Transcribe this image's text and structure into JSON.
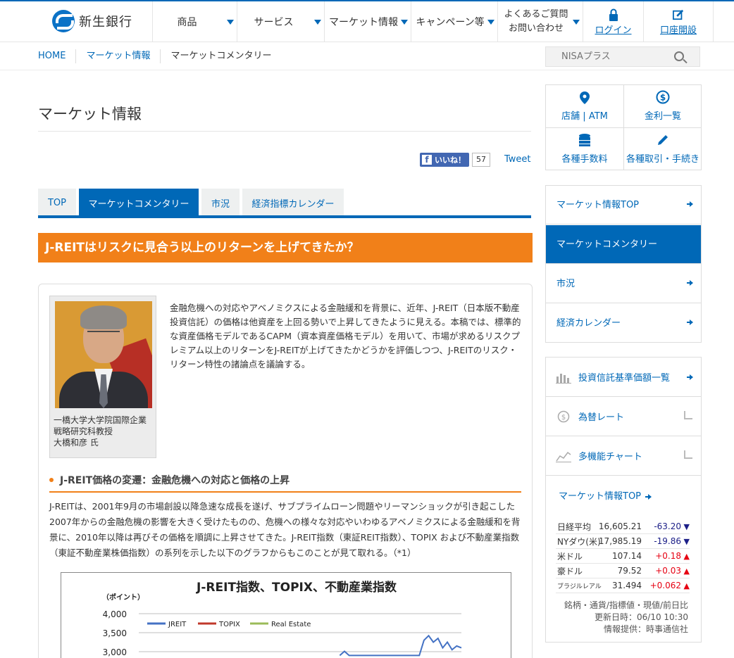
{
  "header": {
    "logo_text": "新生銀行",
    "nav": [
      {
        "label": "商品"
      },
      {
        "label": "サービス"
      },
      {
        "label": "マーケット情報"
      },
      {
        "label": "キャンペーン等"
      }
    ],
    "faq_line1": "よくあるご質問",
    "faq_line2": "お問い合わせ",
    "login": "ログイン",
    "open_account": "口座開設"
  },
  "breadcrumb": [
    "HOME",
    "マーケット情報",
    "マーケットコメンタリー"
  ],
  "search": {
    "placeholder": "NISAプラス"
  },
  "page_title": "マーケット情報",
  "social": {
    "like_label": "いいね！",
    "like_count": "57",
    "tweet": "Tweet"
  },
  "tabs": [
    "TOP",
    "マーケットコメンタリー",
    "市況",
    "経済指標カレンダー"
  ],
  "article": {
    "title": "J-REITはリスクに見合う以上のリターンを上げてきたか？",
    "author_lines": [
      "一橋大学大学院国際企業",
      "戦略研究科教授",
      "大橋和彦 氏"
    ],
    "lead": "金融危機への対応やアベノミクスによる金融緩和を背景に、近年、J-REIT（日本版不動産投資信託）の価格は他資産を上回る勢いで上昇してきたように見える。本稿では、標準的な資産価格モデルであるCAPM（資本資産価格モデル）を用いて、市場が求めるリスクプレミアム以上のリターンをJ-REITが上げてきたかどうかを評価しつつ、J-REITのリスク・リターン特性の諸論点を議論する。",
    "section_heading": "J-REIT価格の変遷：金融危機への対応と価格の上昇",
    "body": "J-REITは、2001年9月の市場創設以降急速な成長を遂げ、サブプライムローン問題やリーマンショックが引き起こした2007年からの金融危機の影響を大きく受けたものの、危機への様々な対応やいわゆるアベノミクスによる金融緩和を背景に、2010年以降は再びその価格を順調に上昇させてきた。J-REIT指数（東証REIT指数）、TOPIX および不動産業指数（東証不動産業株価指数）の系列を示した以下のグラフからもこのことが見て取れる。（*1）"
  },
  "chart_data": {
    "type": "line",
    "title": "J-REIT指数、TOPIX、不動産業指数",
    "ylabel": "（ポイント）",
    "y_ticks": [
      "4,000",
      "3,500",
      "3,000"
    ],
    "ylim": [
      2900,
      4000
    ],
    "legend_placement": "top-left",
    "series": [
      {
        "name": "JREIT",
        "color": "#4472c4",
        "points": [
          [
            0.48,
            2900
          ],
          [
            0.5,
            3010
          ],
          [
            0.52,
            2900
          ],
          [
            0.82,
            2900
          ],
          [
            0.84,
            3300
          ],
          [
            0.86,
            3420
          ],
          [
            0.88,
            3250
          ],
          [
            0.9,
            3350
          ],
          [
            0.92,
            3100
          ],
          [
            0.94,
            3250
          ],
          [
            0.96,
            3050
          ],
          [
            0.98,
            3150
          ],
          [
            1.0,
            3100
          ]
        ]
      },
      {
        "name": "TOPIX",
        "color": "#c0392b",
        "points": []
      },
      {
        "name": "Real Estate",
        "color": "#9bbb59",
        "points": []
      }
    ]
  },
  "quick_links": [
    "店舗",
    "ATM",
    "金利一覧",
    "各種手数料",
    "各種取引・手続き"
  ],
  "side_nav": [
    "マーケット情報TOP",
    "マーケットコメンタリー",
    "市況",
    "経済カレンダー"
  ],
  "market": {
    "links": [
      "投資信託基準価額一覧",
      "為替レート",
      "多機能チャート"
    ],
    "top_link": "マーケット情報TOP",
    "rates": [
      {
        "name": "日経平均",
        "value": "16,605.21",
        "change": "-63.20",
        "dir": "down",
        "mark": "▼"
      },
      {
        "name": "NYダウ(米)",
        "value": "17,985.19",
        "change": "-19.86",
        "dir": "down",
        "mark": "▼"
      },
      {
        "name": "米ドル",
        "value": "107.14",
        "change": "+0.18",
        "dir": "up",
        "mark": "▲"
      },
      {
        "name": "豪ドル",
        "value": "79.52",
        "change": "+0.03",
        "dir": "up",
        "mark": "▲"
      },
      {
        "name": "ブラジルレアル",
        "value": "31.494",
        "change": "+0.062",
        "dir": "up",
        "mark": "▲"
      }
    ],
    "note1": "銘柄・通貨/指標値・現値/前日比",
    "note2": "更新日時：06/10 10:30",
    "note3": "情報提供：時事通信社"
  },
  "colors": {
    "brand_blue": "#0068b7",
    "accent_orange": "#f18019",
    "up_red": "#e60012",
    "down_navy": "#1d2088"
  }
}
